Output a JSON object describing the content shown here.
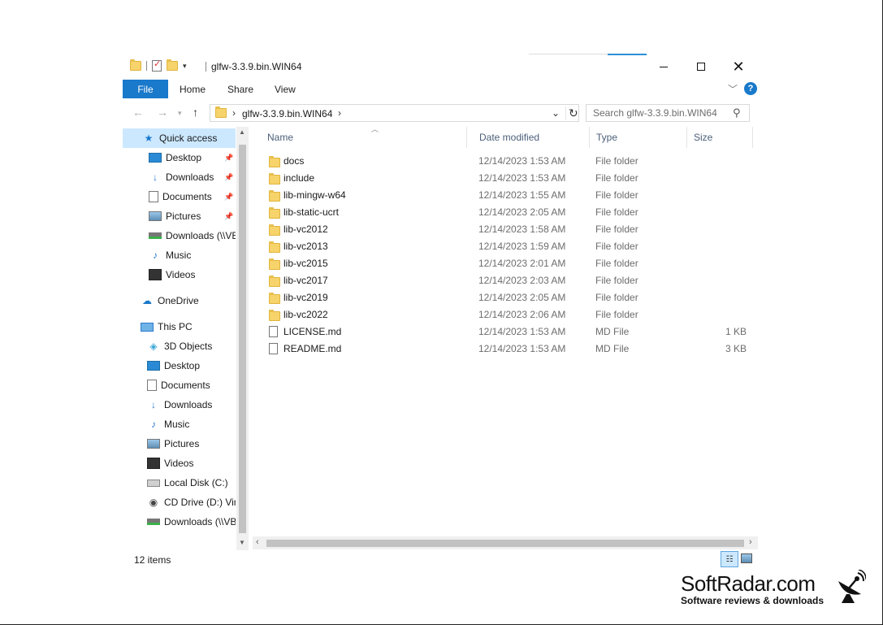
{
  "window": {
    "title": "glfw-3.3.9.bin.WIN64",
    "minimize_label": "—",
    "maximize_label": "☐",
    "close_label": "✕"
  },
  "ribbon": {
    "tabs": [
      "File",
      "Home",
      "Share",
      "View"
    ],
    "help_label": "?"
  },
  "navigation": {
    "back_icon": "←",
    "forward_icon": "→",
    "recent_icon": "▾",
    "up_icon": "↑",
    "address_path": "glfw-3.3.9.bin.WIN64",
    "search_placeholder": "Search glfw-3.3.9.bin.WIN64"
  },
  "sidebar": {
    "items": [
      {
        "label": "Quick access",
        "icon": "star-icon",
        "pinned": false,
        "selected": true
      },
      {
        "label": "Desktop",
        "icon": "desktop-icon",
        "pinned": true
      },
      {
        "label": "Downloads",
        "icon": "downloads-icon",
        "pinned": true
      },
      {
        "label": "Documents",
        "icon": "documents-icon",
        "pinned": true
      },
      {
        "label": "Pictures",
        "icon": "pictures-icon",
        "pinned": true
      },
      {
        "label": "Downloads (\\\\VBoxSvr) (E:)",
        "icon": "network-drive-icon",
        "pinned": false
      },
      {
        "label": "Music",
        "icon": "music-icon",
        "pinned": false
      },
      {
        "label": "Videos",
        "icon": "videos-icon",
        "pinned": false
      },
      {
        "label": "OneDrive",
        "icon": "onedrive-icon",
        "pinned": false
      },
      {
        "label": "This PC",
        "icon": "this-pc-icon",
        "pinned": false
      },
      {
        "label": "3D Objects",
        "icon": "3d-objects-icon",
        "pinned": false
      },
      {
        "label": "Desktop",
        "icon": "desktop-icon",
        "pinned": false
      },
      {
        "label": "Documents",
        "icon": "documents-icon",
        "pinned": false
      },
      {
        "label": "Downloads",
        "icon": "downloads-icon",
        "pinned": false
      },
      {
        "label": "Music",
        "icon": "music-icon",
        "pinned": false
      },
      {
        "label": "Pictures",
        "icon": "pictures-icon",
        "pinned": false
      },
      {
        "label": "Videos",
        "icon": "videos-icon",
        "pinned": false
      },
      {
        "label": "Local Disk (C:)",
        "icon": "local-disk-icon",
        "pinned": false
      },
      {
        "label": "CD Drive (D:) VirtualBox Guest Additions",
        "icon": "cd-drive-icon",
        "pinned": false
      },
      {
        "label": "Downloads (\\\\VBoxSvr) (E:)",
        "icon": "network-drive-icon",
        "pinned": false
      }
    ]
  },
  "columns": {
    "name": "Name",
    "date": "Date modified",
    "type": "Type",
    "size": "Size"
  },
  "files": [
    {
      "name": "docs",
      "date": "12/14/2023 1:53 AM",
      "type": "File folder",
      "size": "",
      "kind": "folder"
    },
    {
      "name": "include",
      "date": "12/14/2023 1:53 AM",
      "type": "File folder",
      "size": "",
      "kind": "folder"
    },
    {
      "name": "lib-mingw-w64",
      "date": "12/14/2023 1:55 AM",
      "type": "File folder",
      "size": "",
      "kind": "folder"
    },
    {
      "name": "lib-static-ucrt",
      "date": "12/14/2023 2:05 AM",
      "type": "File folder",
      "size": "",
      "kind": "folder"
    },
    {
      "name": "lib-vc2012",
      "date": "12/14/2023 1:58 AM",
      "type": "File folder",
      "size": "",
      "kind": "folder"
    },
    {
      "name": "lib-vc2013",
      "date": "12/14/2023 1:59 AM",
      "type": "File folder",
      "size": "",
      "kind": "folder"
    },
    {
      "name": "lib-vc2015",
      "date": "12/14/2023 2:01 AM",
      "type": "File folder",
      "size": "",
      "kind": "folder"
    },
    {
      "name": "lib-vc2017",
      "date": "12/14/2023 2:03 AM",
      "type": "File folder",
      "size": "",
      "kind": "folder"
    },
    {
      "name": "lib-vc2019",
      "date": "12/14/2023 2:05 AM",
      "type": "File folder",
      "size": "",
      "kind": "folder"
    },
    {
      "name": "lib-vc2022",
      "date": "12/14/2023 2:06 AM",
      "type": "File folder",
      "size": "",
      "kind": "folder"
    },
    {
      "name": "LICENSE.md",
      "date": "12/14/2023 1:53 AM",
      "type": "MD File",
      "size": "1 KB",
      "kind": "file"
    },
    {
      "name": "README.md",
      "date": "12/14/2023 1:53 AM",
      "type": "MD File",
      "size": "3 KB",
      "kind": "file"
    }
  ],
  "status": {
    "item_count": "12 items"
  },
  "watermark": {
    "title": "SoftRadar.com",
    "subtitle": "Software reviews & downloads"
  },
  "colors": {
    "accent": "#1979ca",
    "selection": "#cce8ff",
    "folder": "#f7d36b"
  }
}
